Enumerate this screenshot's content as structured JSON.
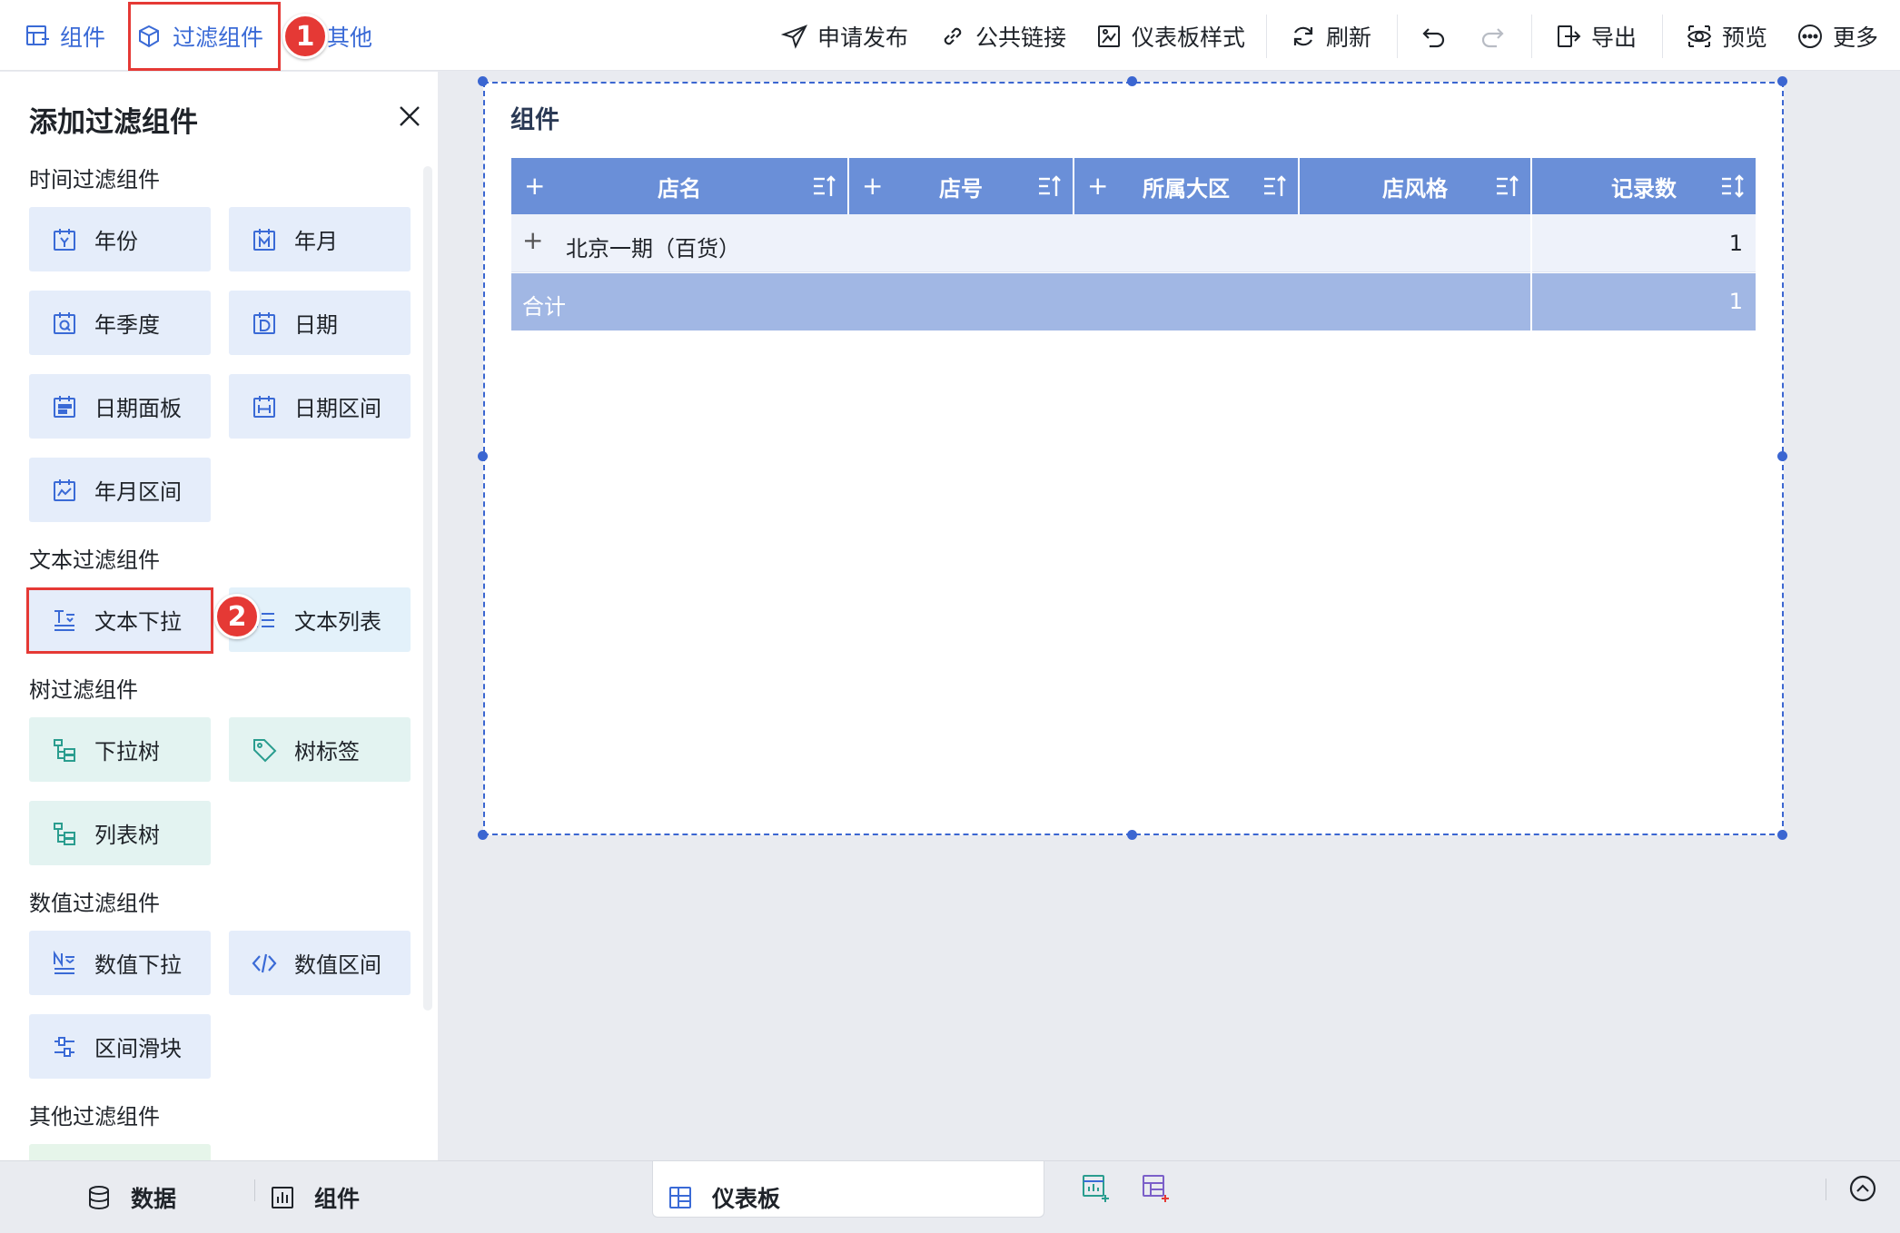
{
  "toolbar": {
    "left": [
      {
        "label": "组件",
        "icon": "add-component-icon"
      },
      {
        "label": "过滤组件",
        "icon": "filter-component-icon"
      },
      {
        "label": "其他"
      }
    ],
    "right": [
      {
        "label": "申请发布",
        "icon": "send-icon"
      },
      {
        "label": "公共链接",
        "icon": "link-icon"
      },
      {
        "label": "仪表板样式",
        "icon": "style-icon"
      },
      {
        "label": "刷新",
        "icon": "refresh-icon"
      },
      {
        "label": "导出",
        "icon": "export-icon"
      },
      {
        "label": "预览",
        "icon": "preview-icon"
      },
      {
        "label": "更多",
        "icon": "more-icon"
      }
    ]
  },
  "steps": [
    "1",
    "2"
  ],
  "panel": {
    "title": "添加过滤组件",
    "sections": [
      {
        "title": "时间过滤组件",
        "items": [
          "年份",
          "年月",
          "年季度",
          "日期",
          "日期面板",
          "日期区间",
          "年月区间"
        ]
      },
      {
        "title": "文本过滤组件",
        "items": [
          "文本下拉",
          "文本列表"
        ]
      },
      {
        "title": "树过滤组件",
        "items": [
          "下拉树",
          "树标签",
          "列表树"
        ]
      },
      {
        "title": "数值过滤组件",
        "items": [
          "数值下拉",
          "数值区间",
          "区间滑块"
        ]
      },
      {
        "title": "其他过滤组件",
        "items": []
      }
    ]
  },
  "widget": {
    "title": "组件",
    "columns": [
      "店名",
      "店号",
      "所属大区",
      "店风格",
      "记录数"
    ],
    "row": {
      "expand": "+",
      "name": "北京一期（百货）",
      "count": "1"
    },
    "total": {
      "label": "合计",
      "count": "1"
    }
  },
  "bottom": {
    "tabs": [
      "数据",
      "组件",
      "仪表板"
    ],
    "active_tab": "仪表板"
  },
  "colors": {
    "accent": "#3a6ad6",
    "highlight": "#e53935",
    "table_header": "#6a8fd8",
    "table_total": "#a1b7e4"
  }
}
